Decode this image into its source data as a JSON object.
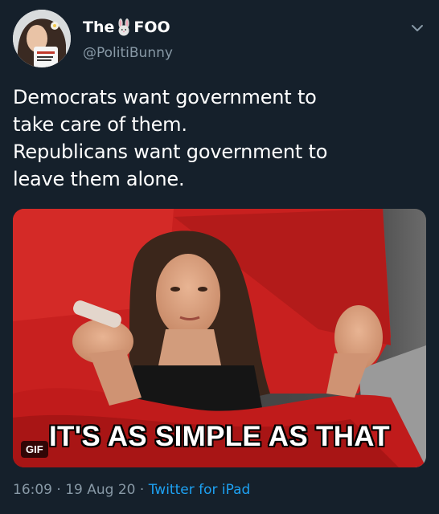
{
  "author": {
    "name_prefix": "The",
    "name_suffix": "FOO",
    "name_emoji": "bunny-emoji",
    "handle": "@PolitiBunny"
  },
  "tweet": {
    "lines": [
      "Democrats want government to",
      "take care of them.",
      "Republicans want government to",
      "leave them alone."
    ]
  },
  "media": {
    "caption": "IT'S AS SIMPLE AS THAT",
    "badge": "GIF"
  },
  "meta": {
    "time": "16:09",
    "separator": "·",
    "date": "19 Aug 20",
    "source": "Twitter for iPad"
  },
  "colors": {
    "background": "#15202b",
    "secondary_text": "#8899a6",
    "link": "#1da1f2",
    "bedding_red": "#c8201f"
  },
  "icons": {
    "menu": "chevron-down-icon"
  }
}
